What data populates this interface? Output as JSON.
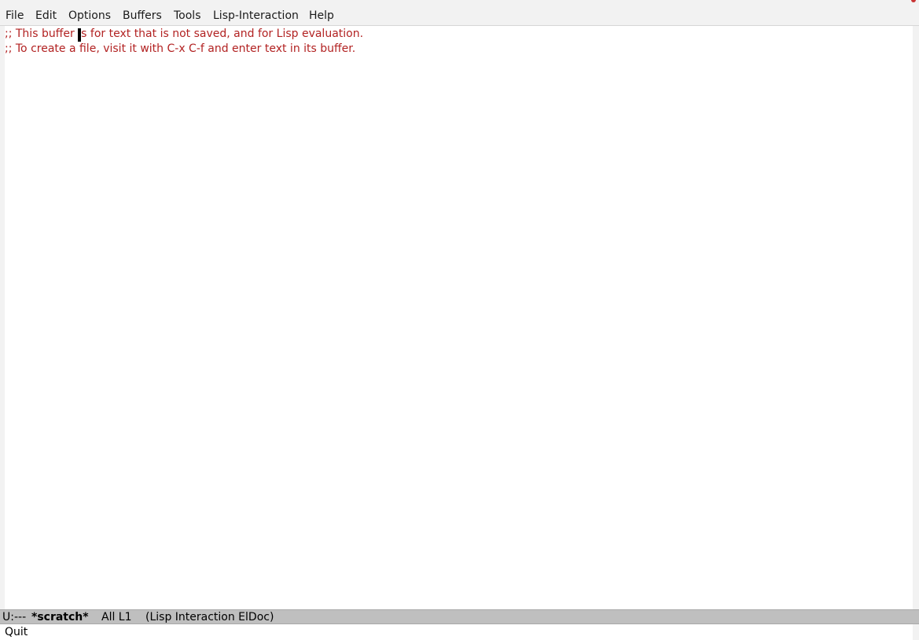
{
  "menubar": {
    "items": [
      {
        "label": "File"
      },
      {
        "label": "Edit"
      },
      {
        "label": "Options"
      },
      {
        "label": "Buffers"
      },
      {
        "label": "Tools"
      },
      {
        "label": "Lisp-Interaction"
      },
      {
        "label": "Help"
      }
    ]
  },
  "buffer": {
    "lines": [
      {
        "before_cursor": ";; This buffer ",
        "cursor_char": "i",
        "after_cursor": "s for text that is not saved, and for Lisp evaluation."
      },
      {
        "text": ";; To create a file, visit it with C-x C-f and enter text in its buffer."
      }
    ],
    "comment_color": "#b22222"
  },
  "modeline": {
    "status": "U:---",
    "buffer_name": "*scratch*",
    "position": "All L1",
    "modes": "(Lisp Interaction ElDoc)"
  },
  "echo_area": {
    "message": "Quit"
  }
}
